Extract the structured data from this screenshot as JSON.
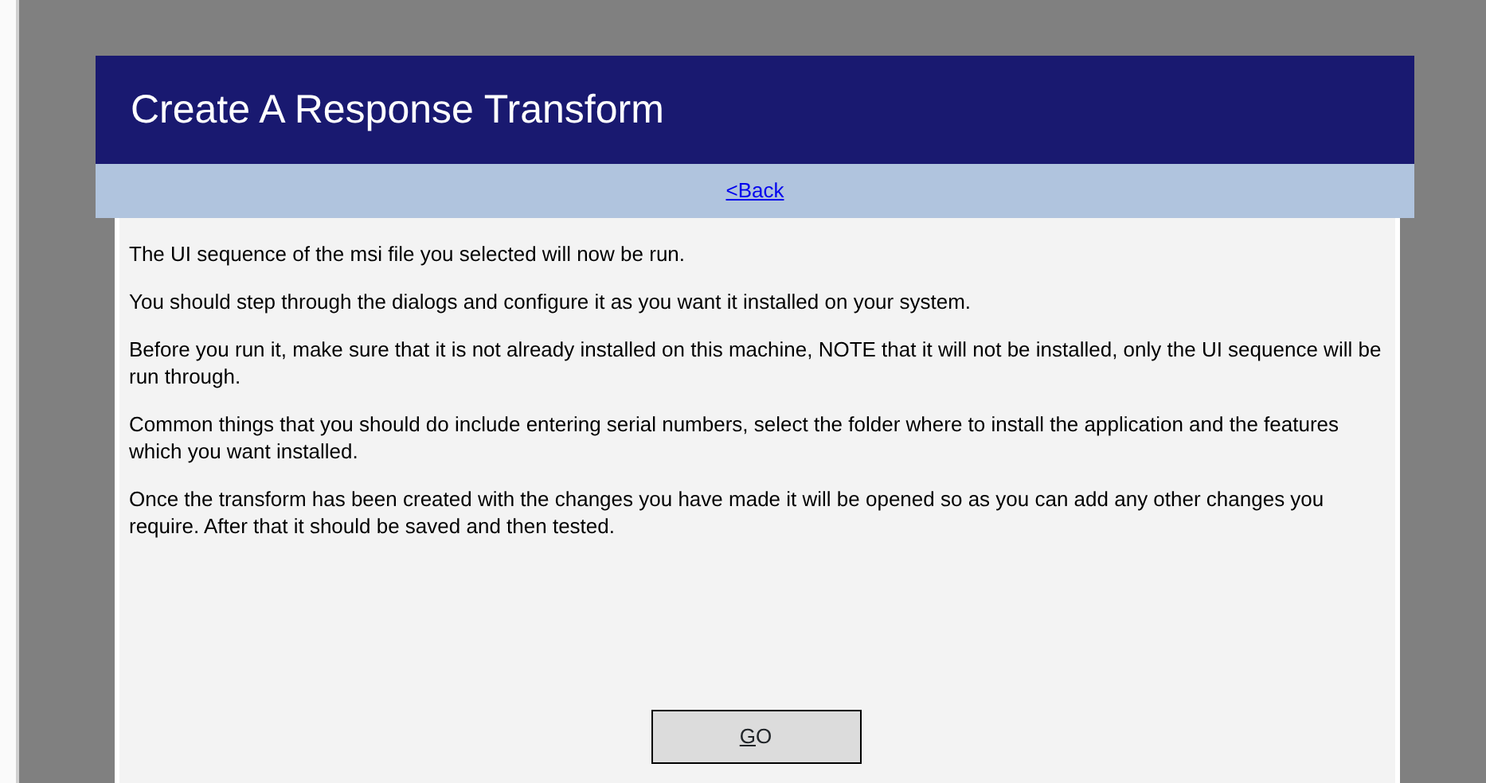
{
  "header": {
    "title": "Create A Response Transform"
  },
  "nav": {
    "back_link": "<Back"
  },
  "paragraphs": [
    "The UI sequence of the msi file you selected will now be run.",
    "You should step through the dialogs and configure it as you want it installed on your system.",
    "Before you run it, make sure that it is not already installed on this machine, NOTE that it will not be installed, only the UI sequence will be run through.",
    "Common things that you should do include entering serial numbers, select the folder where to install the application and the features which you want installed.",
    "Once the transform has been created with the changes you have made it will be opened so as you can add any other changes you require. After that it should be saved and then tested."
  ],
  "button": {
    "label": "GO",
    "mnemonic_underlined": true
  }
}
